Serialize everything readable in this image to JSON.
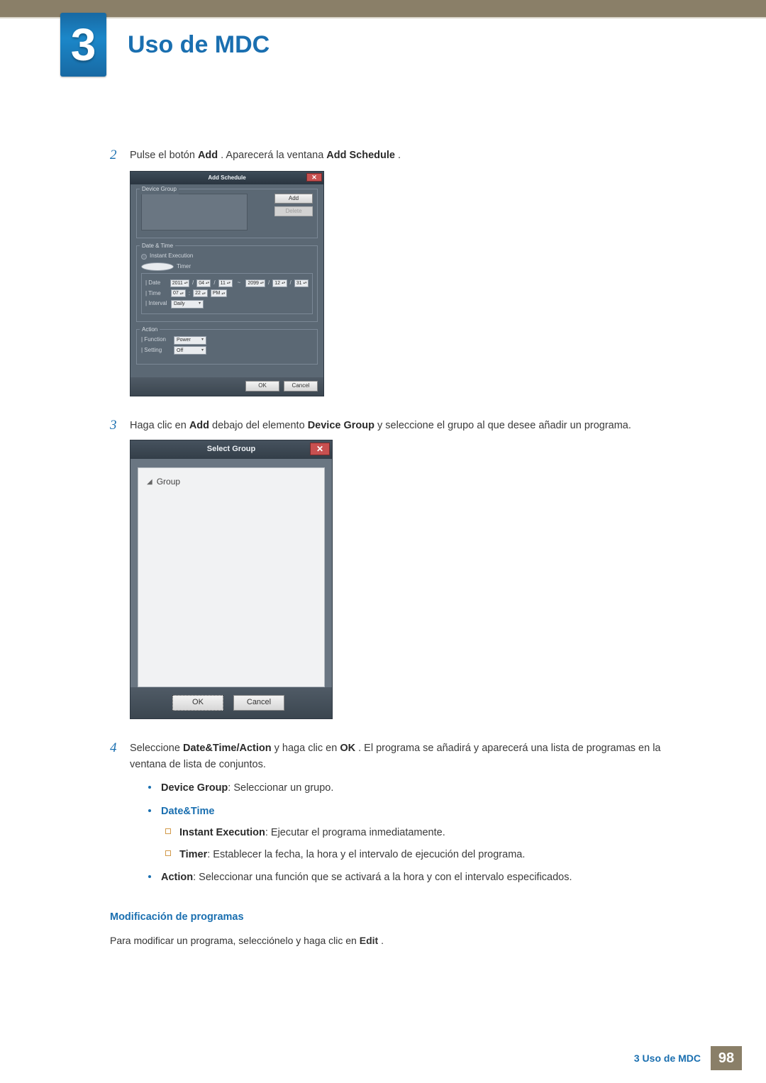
{
  "chapter": {
    "number": "3",
    "title": "Uso de MDC"
  },
  "steps": {
    "s2": {
      "num": "2",
      "p1a": "Pulse el botón ",
      "p1b": "Add",
      "p1c": ". Aparecerá la ventana ",
      "p1d": "Add Schedule",
      "p1e": "."
    },
    "s3": {
      "num": "3",
      "a": "Haga clic en ",
      "b": "Add",
      "c": " debajo del elemento ",
      "d": "Device Group",
      "e": " y seleccione el grupo al que desee añadir un programa."
    },
    "s4": {
      "num": "4",
      "a": "Seleccione ",
      "b": "Date&Time/Action",
      "c": " y haga clic en ",
      "d": "OK",
      "e": ". El programa se añadirá y aparecerá una lista de programas en la ventana de lista de conjuntos."
    }
  },
  "addSchedule": {
    "title": "Add Schedule",
    "deviceGroup": "Device Group",
    "addBtn": "Add",
    "deleteBtn": "Delete",
    "dateTime": "Date & Time",
    "instant": "Instant Execution",
    "timerLabel": "Timer",
    "dateLabel": "| Date",
    "timeLabel": "| Time",
    "intervalLabel": "| Interval",
    "date": {
      "y1": "2011",
      "m1": "04",
      "d1": "11",
      "y2": "2099",
      "m2": "12",
      "d2": "31"
    },
    "time": {
      "h": "07",
      "m": "22",
      "ap": "PM"
    },
    "intervalValue": "Daily",
    "actionLabel": "Action",
    "functionLabel": "| Function",
    "functionValue": "Power",
    "settingLabel": "| Setting",
    "settingValue": "Off",
    "ok": "OK",
    "cancel": "Cancel"
  },
  "selectGroup": {
    "title": "Select Group",
    "item": "Group",
    "ok": "OK",
    "cancel": "Cancel"
  },
  "bullets": {
    "dg_b": "Device Group",
    "dg_t": ": Seleccionar un grupo.",
    "dt_b": "Date&Time",
    "ie_b": "Instant Execution",
    "ie_t": ": Ejecutar el programa inmediatamente.",
    "tm_b": "Timer",
    "tm_t": ": Establecer la fecha, la hora y el intervalo de ejecución del programa.",
    "ac_b": "Action",
    "ac_t": ": Seleccionar una función que se activará a la hora y con el intervalo especificados."
  },
  "modify": {
    "heading": "Modificación de programas",
    "a": "Para modificar un programa, selecciónelo y haga clic en ",
    "b": "Edit",
    "c": "."
  },
  "footer": {
    "text": "3 Uso de MDC",
    "page": "98"
  }
}
